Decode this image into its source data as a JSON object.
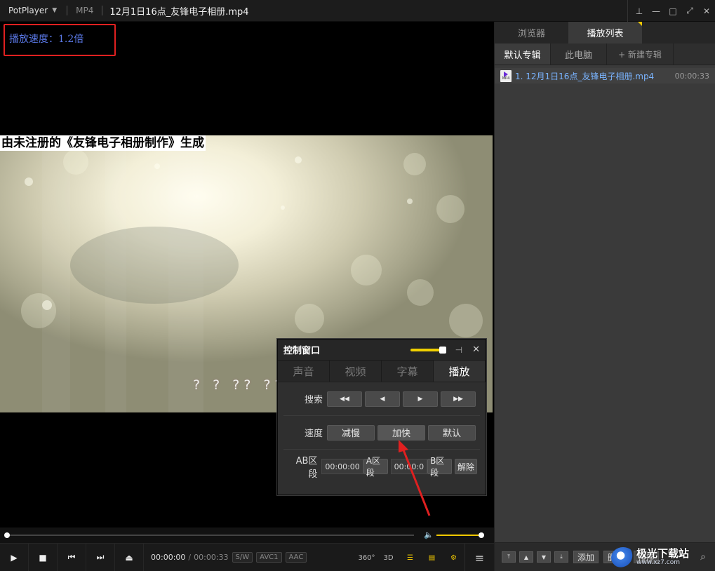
{
  "titlebar": {
    "app_name": "PotPlayer",
    "format": "MP4",
    "file_title": "12月1日16点_友锋电子相册.mp4"
  },
  "osd": {
    "speed_text": "播放速度：1.2倍"
  },
  "video": {
    "watermark": "由未注册的《友锋电子相册制作》生成",
    "subtitle_glyphs": "? ? ?? ??"
  },
  "control_window": {
    "title": "控制窗口",
    "tabs": [
      "声音",
      "视频",
      "字幕",
      "播放"
    ],
    "active_tab": "播放",
    "search_label": "搜索",
    "speed_label": "速度",
    "speed_buttons": [
      "减慢",
      "加快",
      "默认"
    ],
    "ab_label": "AB区段",
    "ab_start_time": "00:00:00",
    "ab_a_button": "A区段",
    "ab_end_time": "00:00:0",
    "ab_b_button": "B区段",
    "ab_clear": "解除"
  },
  "playback": {
    "current_time": "00:00:00",
    "separator": "/",
    "total_time": "00:00:33",
    "codecs": [
      "S/W",
      "AVC1",
      "AAC"
    ],
    "seek_progress": 0.0,
    "volume": 1.0
  },
  "right_icons": [
    "360°",
    "3D"
  ],
  "playlist": {
    "tabs": [
      "浏览器",
      "播放列表"
    ],
    "active_tab": "播放列表",
    "subtabs": [
      "默认专辑",
      "此电脑",
      "+ 新建专辑"
    ],
    "items": [
      {
        "name": "1. 12月1日16点_友锋电子相册.mp4",
        "duration": "00:00:33",
        "icon_label": "MP4"
      }
    ],
    "bottom_buttons": [
      "添加",
      "删除",
      "排序"
    ]
  },
  "site_watermark": {
    "name": "极光下载站",
    "url": "www.xz7.com"
  },
  "colors": {
    "accent_yellow": "#f0c800",
    "osd_border": "#e02020",
    "osd_text": "#5a78e6",
    "playlist_link": "#7ab4ff"
  }
}
